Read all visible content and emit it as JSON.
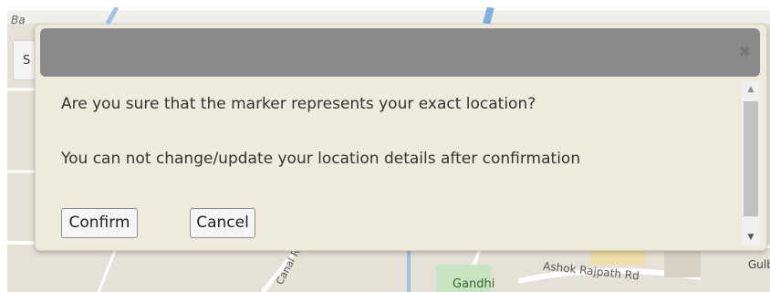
{
  "map": {
    "labels": {
      "top_left": "Ba",
      "canal": "Canal R",
      "gandhi": "Gandhi",
      "ashok": "Ashok Rajpath Rd",
      "gulb": "Gulb"
    },
    "control_label": "S"
  },
  "dialog": {
    "close_glyph": "✖",
    "message_1": "Are you sure that the marker represents your exact location?",
    "message_2": "You can not change/update your location details after confirmation",
    "confirm_label": "Confirm",
    "cancel_label": "Cancel"
  },
  "scrollbar": {
    "up_glyph": "▲",
    "down_glyph": "▼"
  }
}
